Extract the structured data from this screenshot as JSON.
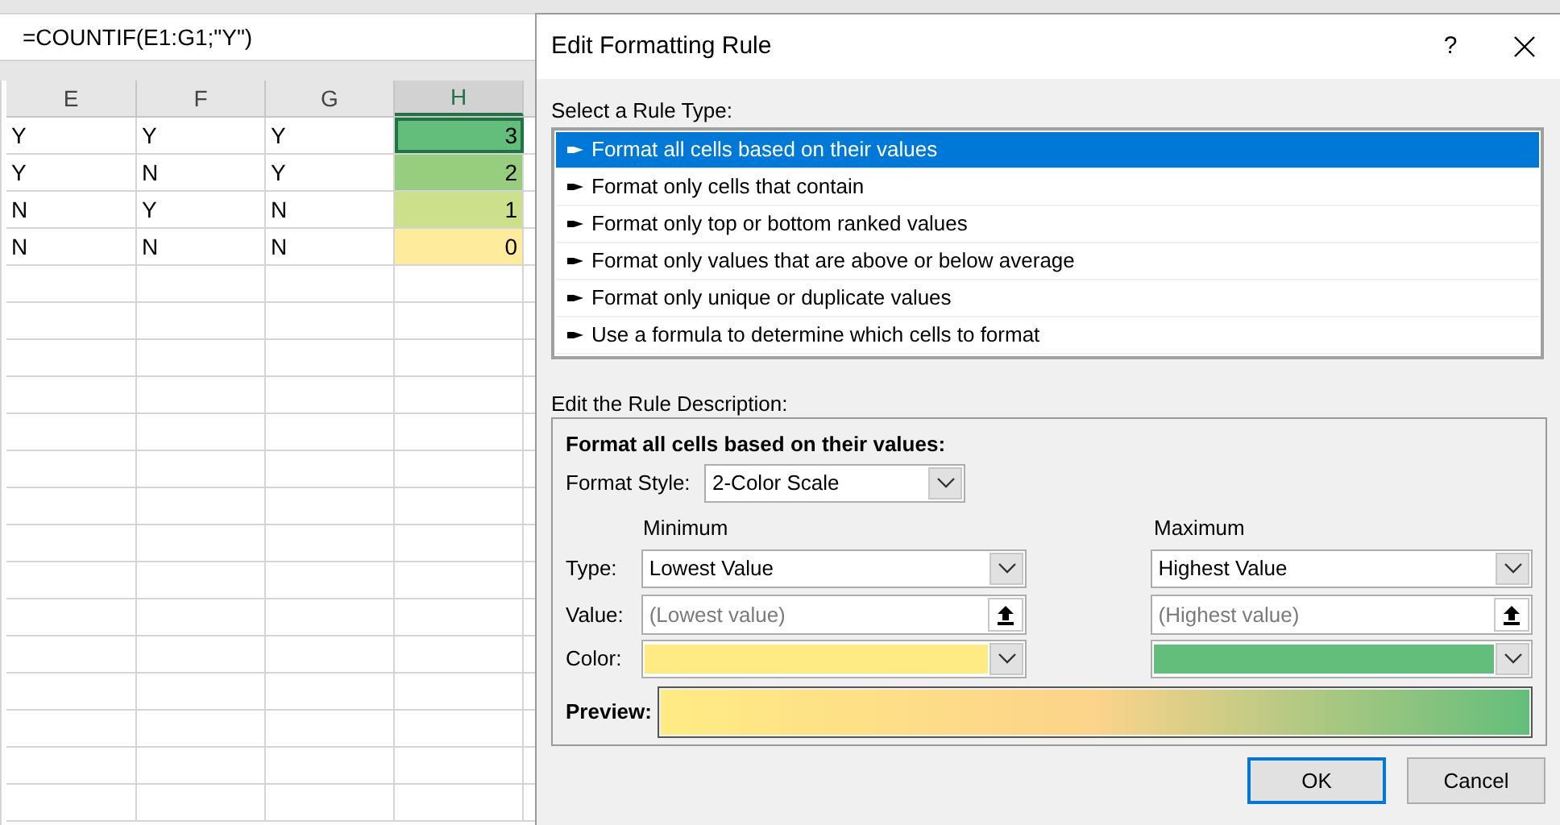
{
  "formula_bar": {
    "value": "=COUNTIF(E1:G1;\"Y\")"
  },
  "sheet": {
    "columns": [
      {
        "label": "E",
        "selected": false
      },
      {
        "label": "F",
        "selected": false
      },
      {
        "label": "G",
        "selected": false
      },
      {
        "label": "H",
        "selected": true
      }
    ],
    "rows": [
      {
        "cells": [
          {
            "value": "Y"
          },
          {
            "value": "Y"
          },
          {
            "value": "Y"
          },
          {
            "value": "3",
            "color": "#63be7b",
            "selected": true
          }
        ]
      },
      {
        "cells": [
          {
            "value": "Y"
          },
          {
            "value": "N"
          },
          {
            "value": "Y"
          },
          {
            "value": "2",
            "color": "#96cd7e",
            "selected": false
          }
        ]
      },
      {
        "cells": [
          {
            "value": "N"
          },
          {
            "value": "Y"
          },
          {
            "value": "N"
          },
          {
            "value": "1",
            "color": "#cbe08a",
            "selected": false
          }
        ]
      },
      {
        "cells": [
          {
            "value": "N"
          },
          {
            "value": "N"
          },
          {
            "value": "N"
          },
          {
            "value": "0",
            "color": "#ffeb9c",
            "selected": false
          }
        ]
      }
    ]
  },
  "dialog": {
    "title": "Edit Formatting Rule",
    "help": "?",
    "rule_type_label": "Select a Rule Type:",
    "rule_types": [
      {
        "label": "Format all cells based on their values",
        "selected": true
      },
      {
        "label": "Format only cells that contain",
        "selected": false
      },
      {
        "label": "Format only top or bottom ranked values",
        "selected": false
      },
      {
        "label": "Format only values that are above or below average",
        "selected": false
      },
      {
        "label": "Format only unique or duplicate values",
        "selected": false
      },
      {
        "label": "Use a formula to determine which cells to format",
        "selected": false
      }
    ],
    "description_label": "Edit the Rule Description:",
    "description_heading": "Format all cells based on their values:",
    "format_style": {
      "label": "Format Style:",
      "value": "2-Color Scale"
    },
    "type_label": "Type:",
    "value_label": "Value:",
    "color_label": "Color:",
    "minimum": {
      "heading": "Minimum",
      "type": "Lowest Value",
      "value_placeholder": "(Lowest value)",
      "color": "#ffeb84"
    },
    "maximum": {
      "heading": "Maximum",
      "type": "Highest Value",
      "value_placeholder": "(Highest value)",
      "color": "#63be7b"
    },
    "preview_label": "Preview:",
    "buttons": [
      {
        "label": "OK",
        "kind": "default"
      },
      {
        "label": "Cancel",
        "kind": "normal"
      }
    ]
  }
}
